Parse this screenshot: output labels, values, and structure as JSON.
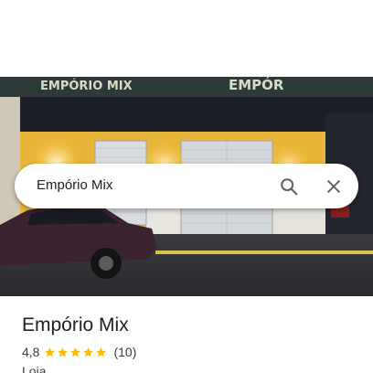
{
  "search": {
    "query": "Empório Mix",
    "search_icon": "search-icon",
    "close_icon": "close-icon"
  },
  "photo": {
    "sign_text_left": "EMPÓRIO MIX",
    "sign_text_right": "EMPÓR"
  },
  "place": {
    "name": "Empório Mix",
    "rating": "4,8",
    "stars": 5,
    "review_count": "(10)",
    "category": "Loja"
  },
  "colors": {
    "star": "#fbbc04",
    "text_primary": "#202124",
    "text_secondary": "#3c4043",
    "icon": "#5f6368"
  }
}
